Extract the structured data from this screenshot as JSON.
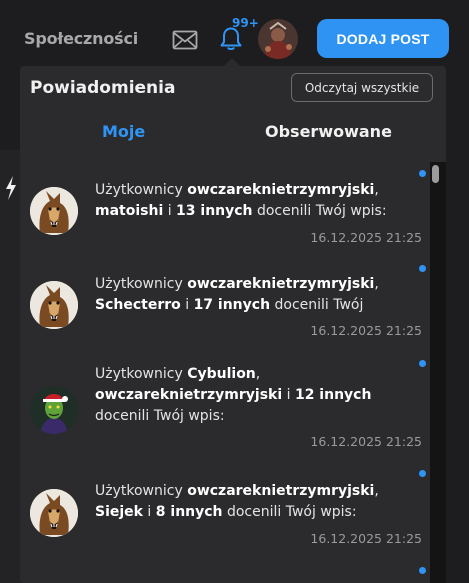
{
  "topbar": {
    "nav_link": "Społeczności",
    "badge": "99+",
    "add_button": "DODAJ POST"
  },
  "panel": {
    "title": "Powiadomienia",
    "read_all": "Odczytaj wszystkie",
    "tabs": [
      {
        "label": "Moje",
        "active": true
      },
      {
        "label": "Obserwowane",
        "active": false
      }
    ]
  },
  "notifications": [
    {
      "prefix": "Użytkownicy ",
      "user1": "owczareknietrzymryjski",
      "sep1": ",",
      "user2": "matoishi",
      "conj": " i ",
      "others": "13 innych",
      "suffix": " docenili Twój wpis:",
      "time": "16.12.2025 21:25",
      "avatar": "dog-avatar"
    },
    {
      "prefix": "Użytkownicy ",
      "user1": "owczareknietrzymryjski",
      "sep1": ",",
      "user2": "Schecterro",
      "conj": " i ",
      "others": "17 innych",
      "suffix": " docenili Twój",
      "time": "16.12.2025 21:25",
      "avatar": "dog-avatar"
    },
    {
      "prefix": "Użytkownicy ",
      "user1": "Cybulion",
      "sep1": ",",
      "user2": "owczareknietrzymryjski",
      "conj": " i ",
      "others": "12 innych",
      "suffix": " docenili Twój wpis:",
      "time": "16.12.2025 21:25",
      "avatar": "grinch-avatar"
    },
    {
      "prefix": "Użytkownicy ",
      "user1": "owczareknietrzymryjski",
      "sep1": ",",
      "user2": "Siejek",
      "conj": " i ",
      "others": "8 innych",
      "suffix": " docenili Twój wpis:",
      "time": "16.12.2025 21:25",
      "avatar": "dog-avatar"
    }
  ],
  "colors": {
    "accent": "#2e93f2",
    "panel": "#2b2b2d",
    "background": "#1d1d1f"
  }
}
